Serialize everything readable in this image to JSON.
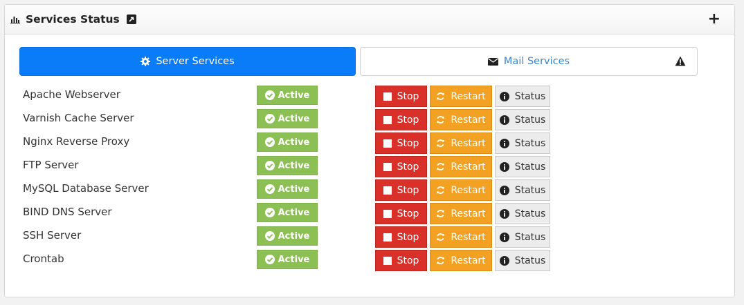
{
  "header": {
    "title": "Services Status"
  },
  "tabs": {
    "server_label": "Server Services",
    "mail_label": "Mail Services"
  },
  "colors": {
    "primary": "#0a7cf7",
    "active": "#8cc055",
    "stop": "#d9302a",
    "restart": "#f3a122",
    "status": "#ececec"
  },
  "services": [
    {
      "name": "Apache Webserver",
      "state": "Active"
    },
    {
      "name": "Varnish Cache Server",
      "state": "Active"
    },
    {
      "name": "Nginx Reverse Proxy",
      "state": "Active"
    },
    {
      "name": "FTP Server",
      "state": "Active"
    },
    {
      "name": "MySQL Database Server",
      "state": "Active"
    },
    {
      "name": "BIND DNS Server",
      "state": "Active"
    },
    {
      "name": "SSH Server",
      "state": "Active"
    },
    {
      "name": "Crontab",
      "state": "Active"
    }
  ],
  "actions": {
    "stop": "Stop",
    "restart": "Restart",
    "status": "Status"
  }
}
